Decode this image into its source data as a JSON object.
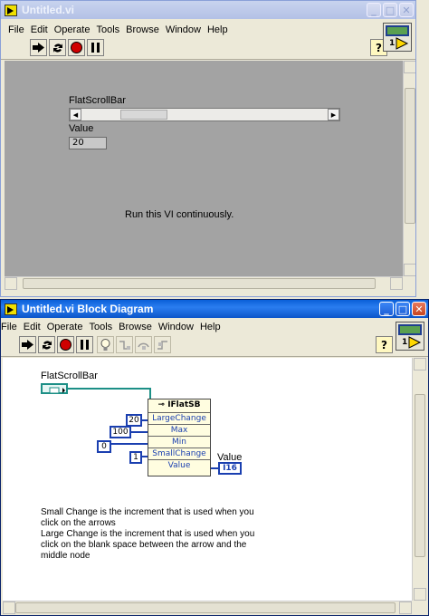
{
  "front_panel": {
    "title": "Untitled.vi",
    "menu": [
      "File",
      "Edit",
      "Operate",
      "Tools",
      "Browse",
      "Window",
      "Help"
    ],
    "scrollbar_label": "FlatScrollBar",
    "value_label": "Value",
    "value": "20",
    "instruction": "Run this VI continuously.",
    "context_help": "?",
    "connector_number": "1"
  },
  "block_diagram": {
    "title": "Untitled.vi Block Diagram",
    "menu": [
      "File",
      "Edit",
      "Operate",
      "Tools",
      "Browse",
      "Window",
      "Help"
    ],
    "scrollbar_terminal_label": "FlatScrollBar",
    "property_node": {
      "title": "IFlatSB",
      "properties": [
        "LargeChange",
        "Max",
        "Min",
        "SmallChange",
        "Value"
      ]
    },
    "constants": {
      "large_change": "20",
      "max": "100",
      "min": "0",
      "small_change": "1"
    },
    "value_indicator_label": "Value",
    "value_indicator_type": "I16",
    "comment": "Small Change is the increment that is used when you\nclick on the arrows\nLarge Change is the increment that is used when you\nclick on the blank space between the arrow and the\nmiddle node",
    "context_help": "?",
    "connector_number": "1"
  },
  "colors": {
    "title_active": "#0a5fd8",
    "panel_gray": "#a3a3a3",
    "wire_blue": "#1a3fb0",
    "wire_teal": "#1c8f86"
  }
}
